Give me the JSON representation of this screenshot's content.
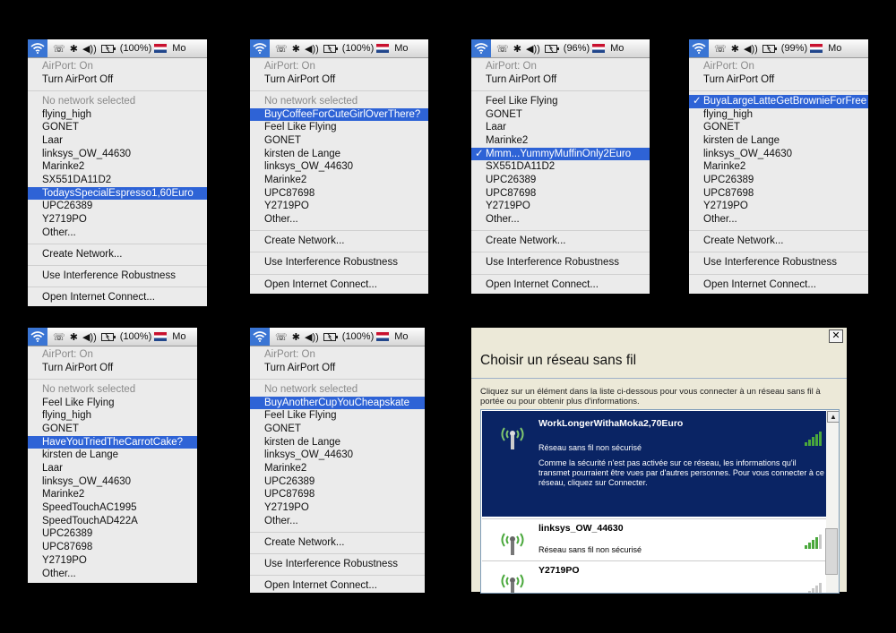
{
  "menubar": {
    "lefts": [
      "☏",
      "✱",
      "◀))"
    ],
    "batteries": [
      "(100%)",
      "(100%)",
      "(96%)",
      "(99%)",
      "(100%)",
      "(100%)"
    ],
    "trailing": "Mo"
  },
  "menus": [
    {
      "items": [
        {
          "label": "AirPort: On",
          "kind": "dim"
        },
        {
          "label": "Turn AirPort Off",
          "kind": "normal"
        },
        {
          "kind": "sep"
        },
        {
          "label": "No network selected",
          "kind": "dim"
        },
        {
          "label": "flying_high",
          "kind": "normal"
        },
        {
          "label": "GONET",
          "kind": "normal"
        },
        {
          "label": "Laar",
          "kind": "normal"
        },
        {
          "label": "linksys_OW_44630",
          "kind": "normal"
        },
        {
          "label": "Marinke2",
          "kind": "normal"
        },
        {
          "label": "SX551DA11D2",
          "kind": "normal"
        },
        {
          "label": "TodaysSpecialEspresso1,60Euro",
          "kind": "sel"
        },
        {
          "label": "UPC26389",
          "kind": "normal"
        },
        {
          "label": "Y2719PO",
          "kind": "normal"
        },
        {
          "label": "Other...",
          "kind": "normal"
        },
        {
          "kind": "sep"
        },
        {
          "label": "Create Network...",
          "kind": "normal"
        },
        {
          "kind": "sep"
        },
        {
          "label": "Use Interference Robustness",
          "kind": "normal"
        },
        {
          "kind": "sep"
        },
        {
          "label": "Open Internet Connect...",
          "kind": "normal"
        }
      ]
    },
    {
      "items": [
        {
          "label": "AirPort: On",
          "kind": "dim"
        },
        {
          "label": "Turn AirPort Off",
          "kind": "normal"
        },
        {
          "kind": "sep"
        },
        {
          "label": "No network selected",
          "kind": "dim"
        },
        {
          "label": "BuyCoffeeForCuteGirlOverThere?",
          "kind": "sel"
        },
        {
          "label": "Feel Like Flying",
          "kind": "normal"
        },
        {
          "label": "GONET",
          "kind": "normal"
        },
        {
          "label": "kirsten de Lange",
          "kind": "normal"
        },
        {
          "label": "linksys_OW_44630",
          "kind": "normal"
        },
        {
          "label": "Marinke2",
          "kind": "normal"
        },
        {
          "label": "UPC87698",
          "kind": "normal"
        },
        {
          "label": "Y2719PO",
          "kind": "normal"
        },
        {
          "label": "Other...",
          "kind": "normal"
        },
        {
          "kind": "sep"
        },
        {
          "label": "Create Network...",
          "kind": "normal"
        },
        {
          "kind": "sep"
        },
        {
          "label": "Use Interference Robustness",
          "kind": "normal"
        },
        {
          "kind": "sep"
        },
        {
          "label": "Open Internet Connect...",
          "kind": "normal"
        }
      ]
    },
    {
      "items": [
        {
          "label": "AirPort: On",
          "kind": "dim"
        },
        {
          "label": "Turn AirPort Off",
          "kind": "normal"
        },
        {
          "kind": "sep"
        },
        {
          "label": "Feel Like Flying",
          "kind": "normal"
        },
        {
          "label": "GONET",
          "kind": "normal"
        },
        {
          "label": "Laar",
          "kind": "normal"
        },
        {
          "label": "Marinke2",
          "kind": "normal"
        },
        {
          "label": "Mmm...YummyMuffinOnly2Euro",
          "kind": "sel checked"
        },
        {
          "label": "SX551DA11D2",
          "kind": "normal"
        },
        {
          "label": "UPC26389",
          "kind": "normal"
        },
        {
          "label": "UPC87698",
          "kind": "normal"
        },
        {
          "label": "Y2719PO",
          "kind": "normal"
        },
        {
          "label": "Other...",
          "kind": "normal"
        },
        {
          "kind": "sep"
        },
        {
          "label": "Create Network...",
          "kind": "normal"
        },
        {
          "kind": "sep"
        },
        {
          "label": "Use Interference Robustness",
          "kind": "normal"
        },
        {
          "kind": "sep"
        },
        {
          "label": "Open Internet Connect...",
          "kind": "normal"
        }
      ]
    },
    {
      "items": [
        {
          "label": "AirPort: On",
          "kind": "dim"
        },
        {
          "label": "Turn AirPort Off",
          "kind": "normal"
        },
        {
          "kind": "sep"
        },
        {
          "label": "BuyaLargeLatteGetBrownieForFree",
          "kind": "sel checked"
        },
        {
          "label": "flying_high",
          "kind": "normal"
        },
        {
          "label": "GONET",
          "kind": "normal"
        },
        {
          "label": "kirsten de Lange",
          "kind": "normal"
        },
        {
          "label": "linksys_OW_44630",
          "kind": "normal"
        },
        {
          "label": "Marinke2",
          "kind": "normal"
        },
        {
          "label": "UPC26389",
          "kind": "normal"
        },
        {
          "label": "UPC87698",
          "kind": "normal"
        },
        {
          "label": "Y2719PO",
          "kind": "normal"
        },
        {
          "label": "Other...",
          "kind": "normal"
        },
        {
          "kind": "sep"
        },
        {
          "label": "Create Network...",
          "kind": "normal"
        },
        {
          "kind": "sep"
        },
        {
          "label": "Use Interference Robustness",
          "kind": "normal"
        },
        {
          "kind": "sep"
        },
        {
          "label": "Open Internet Connect...",
          "kind": "normal"
        }
      ]
    },
    {
      "items": [
        {
          "label": "AirPort: On",
          "kind": "dim"
        },
        {
          "label": "Turn AirPort Off",
          "kind": "normal"
        },
        {
          "kind": "sep"
        },
        {
          "label": "No network selected",
          "kind": "dim"
        },
        {
          "label": "Feel Like Flying",
          "kind": "normal"
        },
        {
          "label": "flying_high",
          "kind": "normal"
        },
        {
          "label": "GONET",
          "kind": "normal"
        },
        {
          "label": "HaveYouTriedTheCarrotCake?",
          "kind": "sel"
        },
        {
          "label": "kirsten de Lange",
          "kind": "normal"
        },
        {
          "label": "Laar",
          "kind": "normal"
        },
        {
          "label": "linksys_OW_44630",
          "kind": "normal"
        },
        {
          "label": "Marinke2",
          "kind": "normal"
        },
        {
          "label": "SpeedTouchAC1995",
          "kind": "normal"
        },
        {
          "label": "SpeedTouchAD422A",
          "kind": "normal"
        },
        {
          "label": "UPC26389",
          "kind": "normal"
        },
        {
          "label": "UPC87698",
          "kind": "normal"
        },
        {
          "label": "Y2719PO",
          "kind": "normal"
        },
        {
          "label": "Other...",
          "kind": "normal"
        }
      ]
    },
    {
      "items": [
        {
          "label": "AirPort: On",
          "kind": "dim"
        },
        {
          "label": "Turn AirPort Off",
          "kind": "normal"
        },
        {
          "kind": "sep"
        },
        {
          "label": "No network selected",
          "kind": "dim"
        },
        {
          "label": "BuyAnotherCupYouCheapskate",
          "kind": "sel"
        },
        {
          "label": "Feel Like Flying",
          "kind": "normal"
        },
        {
          "label": "GONET",
          "kind": "normal"
        },
        {
          "label": "kirsten de Lange",
          "kind": "normal"
        },
        {
          "label": "linksys_OW_44630",
          "kind": "normal"
        },
        {
          "label": "Marinke2",
          "kind": "normal"
        },
        {
          "label": "UPC26389",
          "kind": "normal"
        },
        {
          "label": "UPC87698",
          "kind": "normal"
        },
        {
          "label": "Y2719PO",
          "kind": "normal"
        },
        {
          "label": "Other...",
          "kind": "normal"
        },
        {
          "kind": "sep"
        },
        {
          "label": "Create Network...",
          "kind": "normal"
        },
        {
          "kind": "sep"
        },
        {
          "label": "Use Interference Robustness",
          "kind": "normal"
        },
        {
          "kind": "sep"
        },
        {
          "label": "Open Internet Connect...",
          "kind": "normal"
        }
      ]
    }
  ],
  "windows_dialog": {
    "close_label": "✕",
    "title": "Choisir un réseau sans fil",
    "instructions": "Cliquez sur un élément dans la liste ci-dessous pour vous connecter à un réseau sans fil à portée ou pour obtenir plus d'informations.",
    "scroll_up": "▲",
    "networks": [
      {
        "name": "WorkLongerWithaMoka2,70Euro",
        "status": "Réseau sans fil non sécurisé",
        "description": "Comme la sécurité n'est pas activée sur ce réseau, les informations qu'il transmet pourraient être vues par d'autres personnes. Pour vous connecter à ce réseau, cliquez sur Connecter.",
        "signal_bars": 5
      },
      {
        "name": "linksys_OW_44630",
        "status": "Réseau sans fil non sécurisé",
        "signal_bars": 4
      },
      {
        "name": "Y2719PO",
        "status": "",
        "signal_bars": 1
      }
    ]
  },
  "colors": {
    "mac_highlight": "#2e63d6",
    "mac_menu_bg": "#ebebeb",
    "win_selected_bg": "#0a2464",
    "signal_green": "#4aa83c"
  }
}
